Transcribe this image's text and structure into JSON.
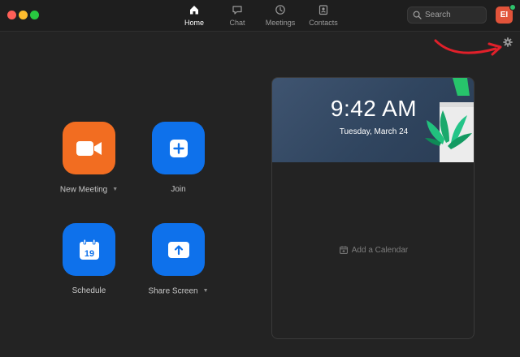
{
  "window": {
    "controls": {
      "close_color": "#fe5f57",
      "minimize_color": "#febc2e",
      "zoom_color": "#28c840"
    }
  },
  "nav": {
    "tabs": [
      {
        "label": "Home",
        "icon": "home-icon",
        "active": true
      },
      {
        "label": "Chat",
        "icon": "chat-bubble-icon",
        "active": false
      },
      {
        "label": "Meetings",
        "icon": "clock-icon",
        "active": false
      },
      {
        "label": "Contacts",
        "icon": "contact-card-icon",
        "active": false
      }
    ]
  },
  "search": {
    "placeholder": "Search",
    "icon": "search-icon"
  },
  "user": {
    "avatar_initials": "EI",
    "avatar_color": "#e1533a",
    "status_color": "#2ec26c"
  },
  "settings": {
    "icon": "gear-icon",
    "annotation_color": "#e0202a"
  },
  "actions": [
    {
      "label": "New Meeting",
      "icon": "video-camera-icon",
      "color": "#f26d21",
      "has_dropdown": true
    },
    {
      "label": "Join",
      "icon": "plus-icon",
      "color": "#0e71eb",
      "has_dropdown": false
    },
    {
      "label": "Schedule",
      "icon": "calendar-icon",
      "color": "#0e71eb",
      "has_dropdown": false,
      "calendar_day": "19"
    },
    {
      "label": "Share Screen",
      "icon": "share-up-arrow-icon",
      "color": "#0e71eb",
      "has_dropdown": true
    }
  ],
  "calendar": {
    "time": "9:42 AM",
    "date": "Tuesday, March 24",
    "add_calendar_label": "Add a Calendar",
    "header_color": "#34495f"
  }
}
